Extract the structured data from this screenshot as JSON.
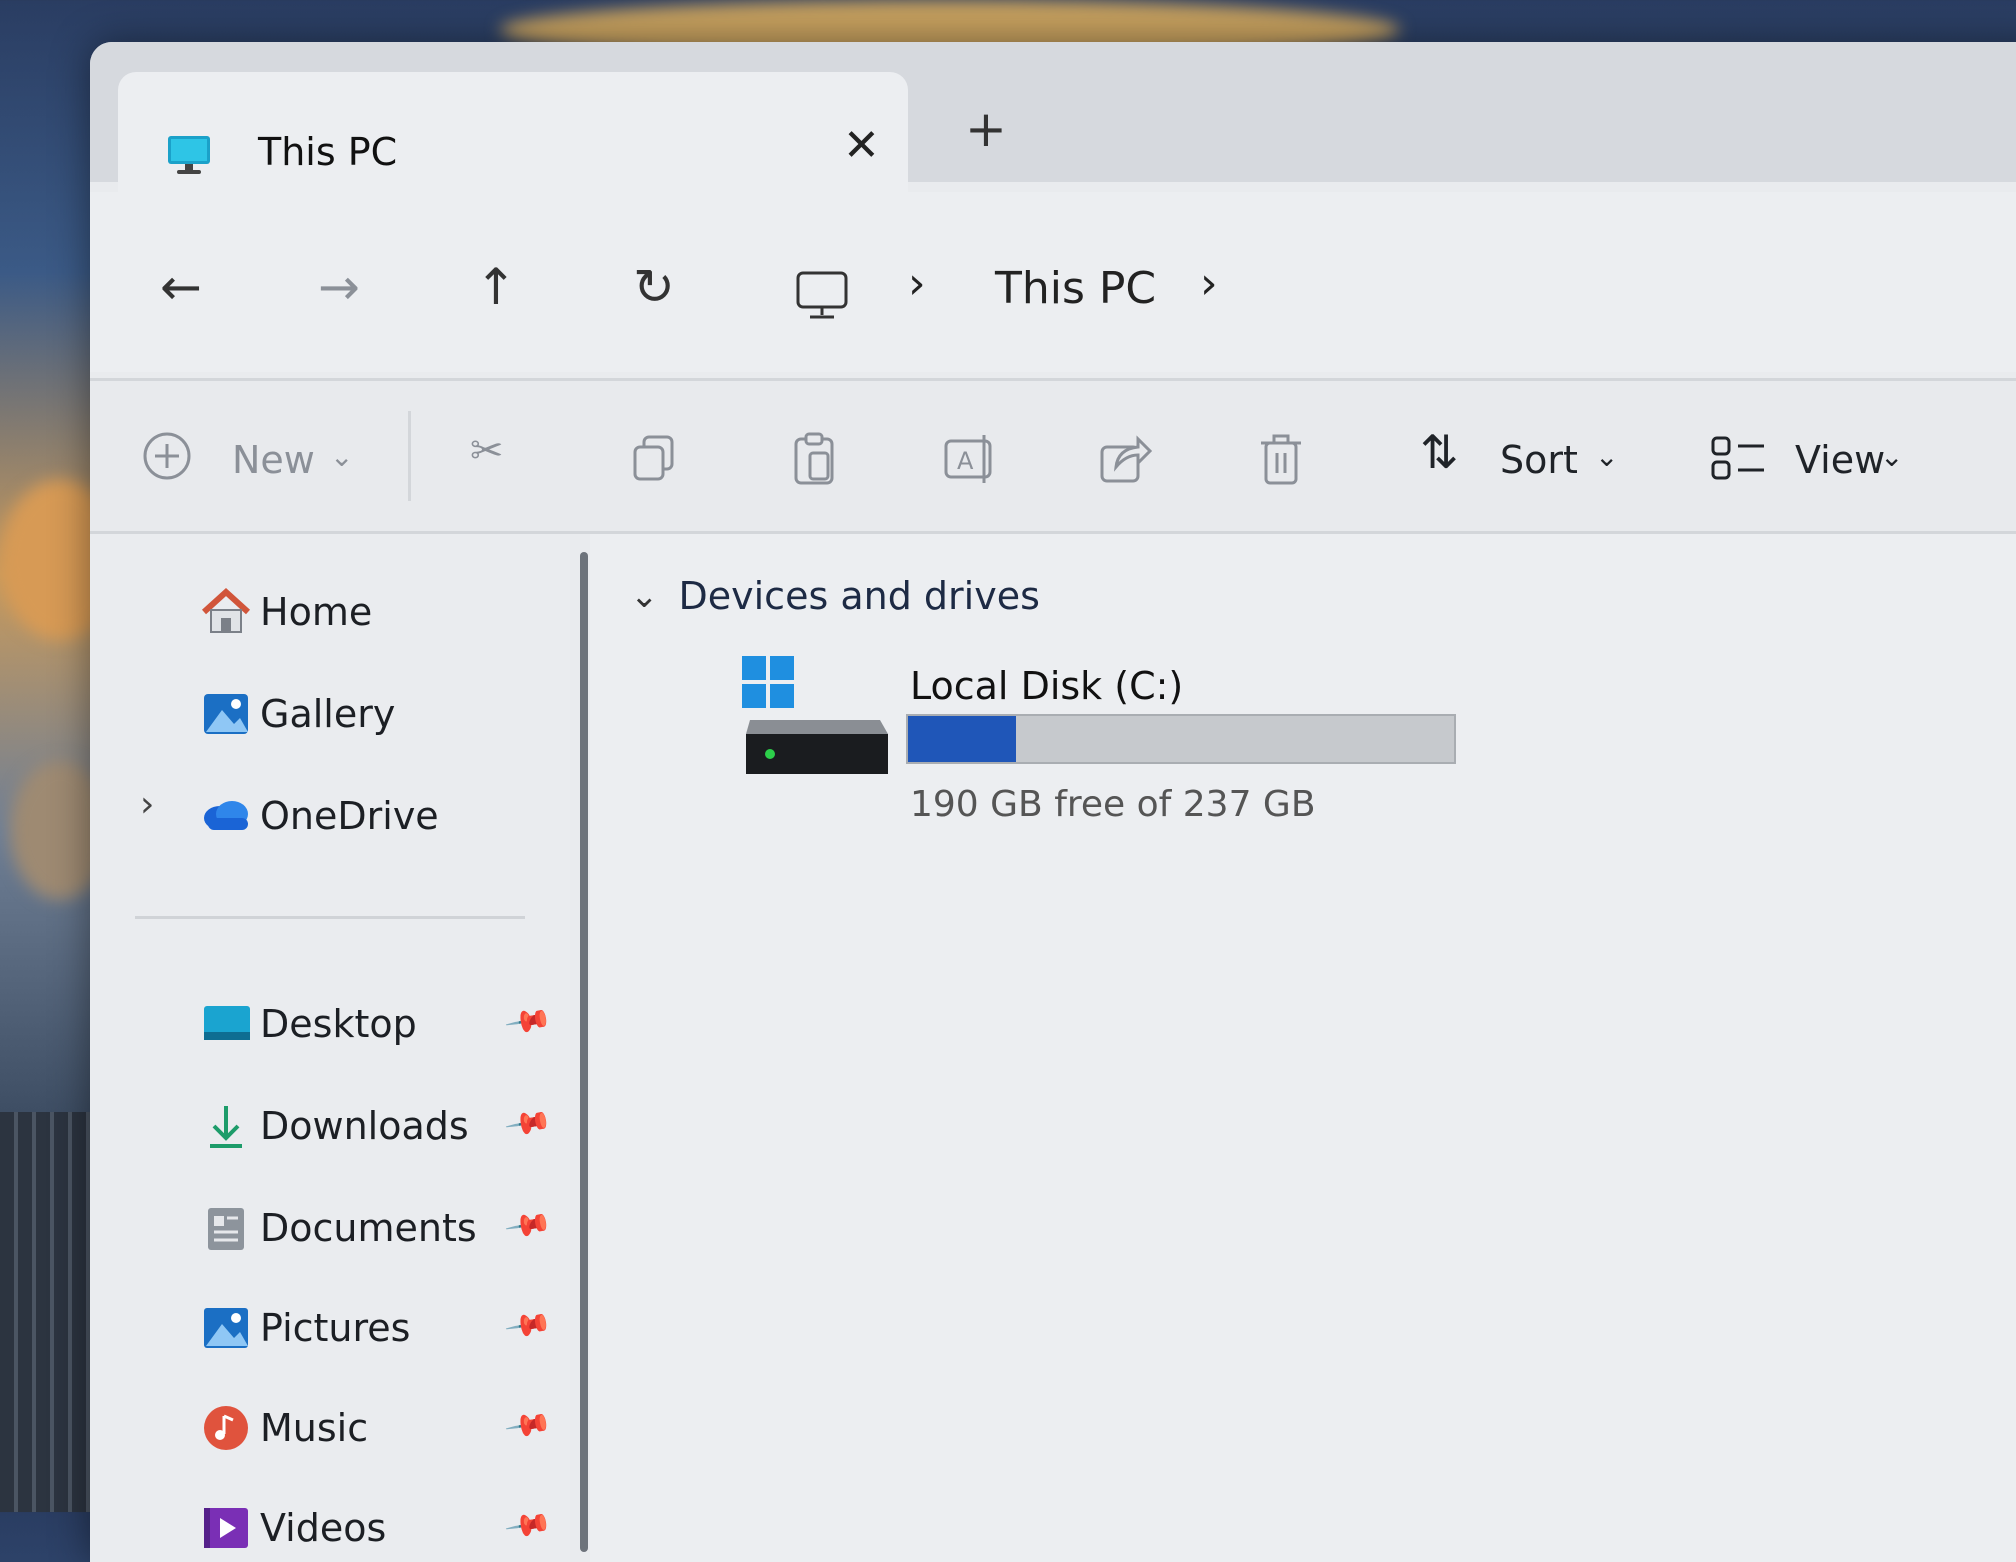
{
  "tab": {
    "title": "This PC",
    "close_icon": "close-icon",
    "new_tab_icon": "plus-icon"
  },
  "nav": {
    "back_icon": "arrow-left-icon",
    "forward_icon": "arrow-right-icon",
    "up_icon": "arrow-up-icon",
    "refresh_icon": "refresh-icon",
    "breadcrumb": [
      "This PC"
    ]
  },
  "toolbar": {
    "new_label": "New",
    "sort_label": "Sort",
    "view_label": "View"
  },
  "sidebar": {
    "items": [
      {
        "label": "Home",
        "icon": "home-icon"
      },
      {
        "label": "Gallery",
        "icon": "gallery-icon"
      },
      {
        "label": "OneDrive",
        "icon": "onedrive-icon"
      }
    ],
    "pinned": [
      {
        "label": "Desktop",
        "icon": "desktop-icon"
      },
      {
        "label": "Downloads",
        "icon": "downloads-icon"
      },
      {
        "label": "Documents",
        "icon": "documents-icon"
      },
      {
        "label": "Pictures",
        "icon": "pictures-icon"
      },
      {
        "label": "Music",
        "icon": "music-icon"
      },
      {
        "label": "Videos",
        "icon": "videos-icon"
      }
    ]
  },
  "content": {
    "section_title": "Devices and drives",
    "drives": [
      {
        "name": "Local Disk (C:)",
        "free_text": "190 GB free of 237 GB",
        "used_fraction": 0.198
      }
    ]
  },
  "colors": {
    "accent": "#1f56b8",
    "bar_bg": "#c6c9cd"
  }
}
